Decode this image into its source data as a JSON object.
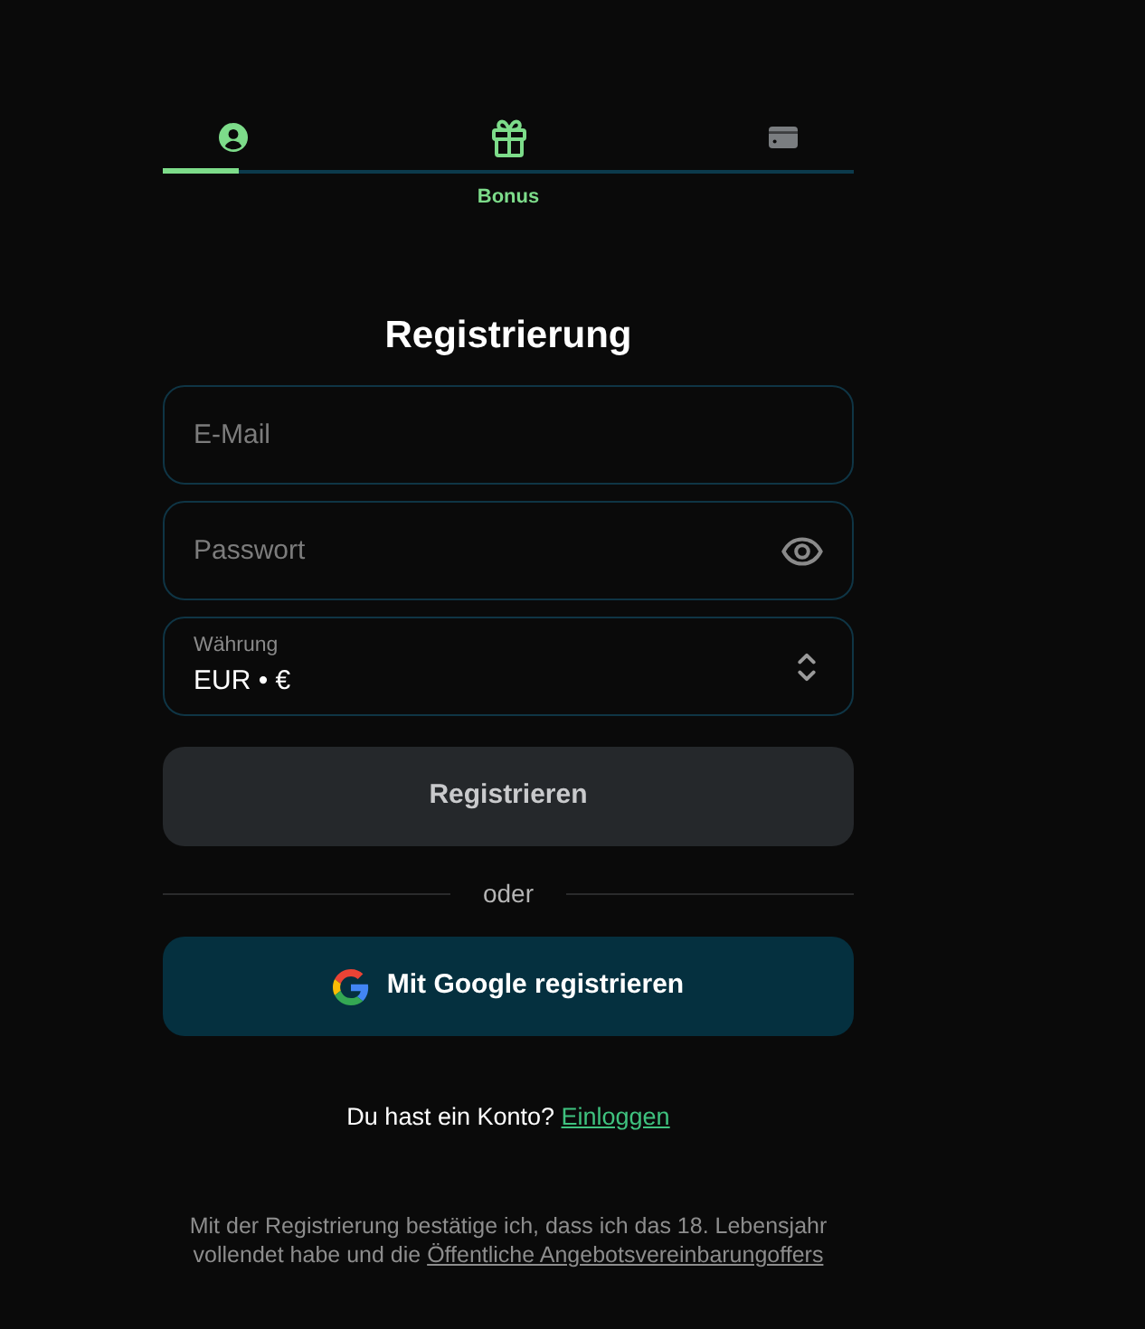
{
  "steps": [
    {
      "kind": "account",
      "active": true
    },
    {
      "kind": "bonus",
      "label": "Bonus",
      "active": true
    },
    {
      "kind": "payment",
      "active": false
    }
  ],
  "progress": {
    "level": 0.11
  },
  "title": "Registrierung",
  "fields": [
    {
      "kind": "email",
      "placeholder": "E-Mail"
    },
    {
      "kind": "password",
      "placeholder": "Passwort"
    },
    {
      "kind": "select",
      "label": "Währung",
      "value": "EUR • €"
    }
  ],
  "register_button": {
    "label": "Registrieren",
    "disabled": true
  },
  "divider": "oder",
  "google_button": {
    "label": "Mit Google registrieren"
  },
  "login_prompt": {
    "text": "Du hast ein Konto?",
    "link": "Einloggen"
  },
  "terms": {
    "text": "Mit der Registrierung bestätige ich, dass ich das 18. Lebensjahr vollendet habe und die",
    "link": "Öffentliche Angebotsvereinbarungoffers"
  }
}
